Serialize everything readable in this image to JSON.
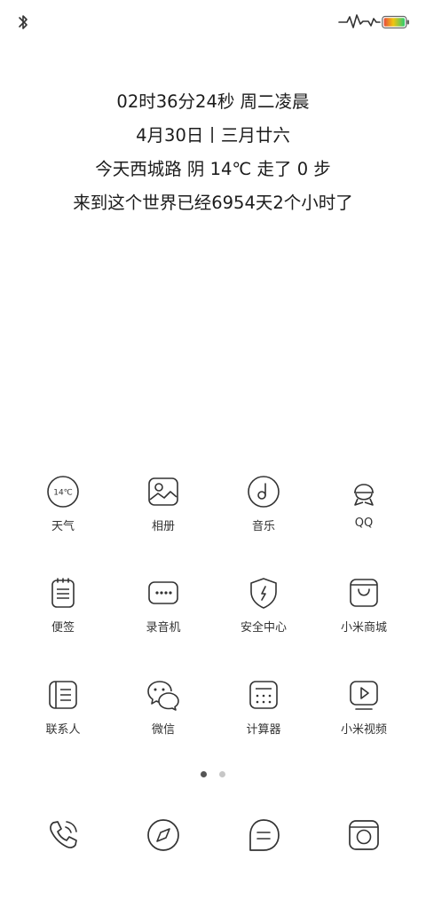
{
  "status_bar": {
    "left_icons": [
      "bluetooth-icon"
    ],
    "right_icons": [
      "heart-rate-icon",
      "battery-icon"
    ],
    "battery_colors": [
      "#2ecc71",
      "#f1c40f",
      "#e74c3c"
    ]
  },
  "info": {
    "time_line": "02时36分24秒  周二凌晨",
    "date_line": "4月30日丨三月廿六",
    "weather_line": "今天西城路 阴 14℃  走了 0 步",
    "life_line": "来到这个世界已经6954天2个小时了"
  },
  "apps": [
    {
      "label": "天气",
      "icon": "weather-icon",
      "icon_text": "14℃"
    },
    {
      "label": "相册",
      "icon": "gallery-icon"
    },
    {
      "label": "音乐",
      "icon": "music-icon"
    },
    {
      "label": "QQ",
      "icon": "qq-icon"
    },
    {
      "label": "便签",
      "icon": "notes-icon"
    },
    {
      "label": "录音机",
      "icon": "recorder-icon"
    },
    {
      "label": "安全中心",
      "icon": "security-icon"
    },
    {
      "label": "小米商城",
      "icon": "mi-store-icon"
    },
    {
      "label": "联系人",
      "icon": "contacts-icon"
    },
    {
      "label": "微信",
      "icon": "wechat-icon"
    },
    {
      "label": "计算器",
      "icon": "calculator-icon"
    },
    {
      "label": "小米视频",
      "icon": "mi-video-icon"
    }
  ],
  "pager": {
    "pages": 2,
    "current": 1
  },
  "dock": [
    {
      "icon": "phone-icon"
    },
    {
      "icon": "browser-icon"
    },
    {
      "icon": "messages-icon"
    },
    {
      "icon": "camera-icon"
    }
  ]
}
